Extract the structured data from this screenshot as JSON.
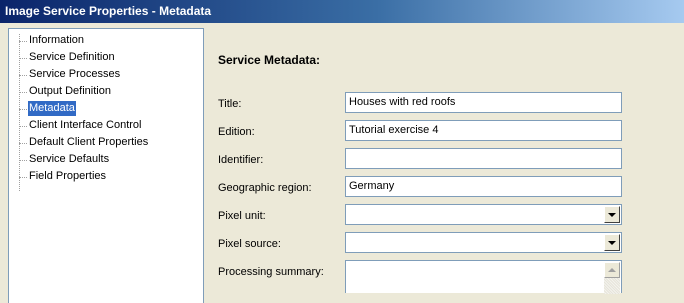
{
  "window": {
    "title": "Image Service Properties - Metadata"
  },
  "tree": {
    "items": [
      {
        "label": "Information",
        "selected": false
      },
      {
        "label": "Service Definition",
        "selected": false
      },
      {
        "label": "Service Processes",
        "selected": false
      },
      {
        "label": "Output Definition",
        "selected": false
      },
      {
        "label": "Metadata",
        "selected": true
      },
      {
        "label": "Client Interface Control",
        "selected": false
      },
      {
        "label": "Default Client Properties",
        "selected": false
      },
      {
        "label": "Service Defaults",
        "selected": false
      },
      {
        "label": "Field Properties",
        "selected": false
      }
    ]
  },
  "metadata": {
    "section_title": "Service Metadata:",
    "fields": {
      "title": {
        "label": "Title:",
        "value": "Houses with red roofs"
      },
      "edition": {
        "label": "Edition:",
        "value": "Tutorial exercise 4"
      },
      "identifier": {
        "label": "Identifier:",
        "value": ""
      },
      "geographic_region": {
        "label": "Geographic region:",
        "value": "Germany"
      },
      "pixel_unit": {
        "label": "Pixel unit:",
        "value": ""
      },
      "pixel_source": {
        "label": "Pixel source:",
        "value": ""
      },
      "processing_summary": {
        "label": "Processing summary:",
        "value": ""
      }
    }
  },
  "colors": {
    "selection": "#316AC5",
    "titlebar_start": "#0A246A",
    "titlebar_end": "#A6CAF0",
    "dialog_bg": "#ECE9D8"
  }
}
